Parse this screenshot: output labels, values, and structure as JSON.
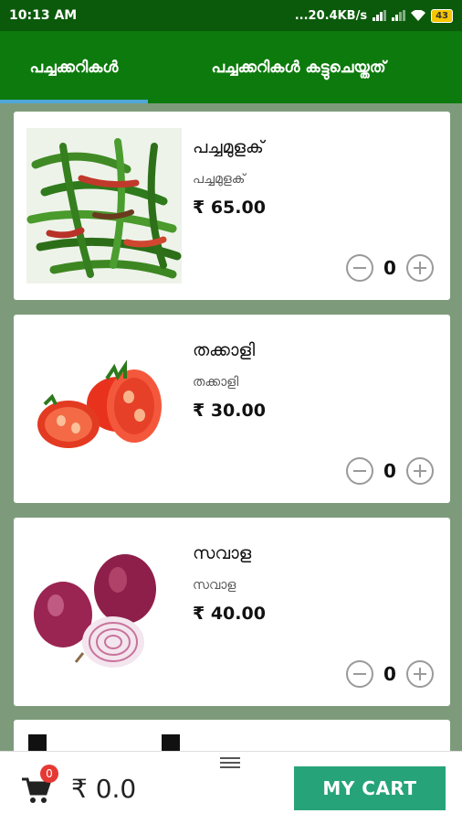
{
  "status": {
    "time": "10:13 AM",
    "network": "...20.4KB/s",
    "battery": "43"
  },
  "tabs": [
    {
      "label": "പച്ചക്കറികൾ"
    },
    {
      "label": "പച്ചക്കറികൾ കട്ടുചെയ്തത്"
    }
  ],
  "products": [
    {
      "name": "പച്ചമുളക്",
      "subtitle": "പച്ചമുളക്",
      "price": "₹ 65.00",
      "qty": "0"
    },
    {
      "name": "തക്കാളി",
      "subtitle": "തക്കാളി",
      "price": "₹ 30.00",
      "qty": "0"
    },
    {
      "name": "സവാള",
      "subtitle": "സവാള",
      "price": "₹ 40.00",
      "qty": "0"
    }
  ],
  "cart": {
    "badge": "0",
    "total": "₹ 0.0",
    "button": "MY CART"
  }
}
